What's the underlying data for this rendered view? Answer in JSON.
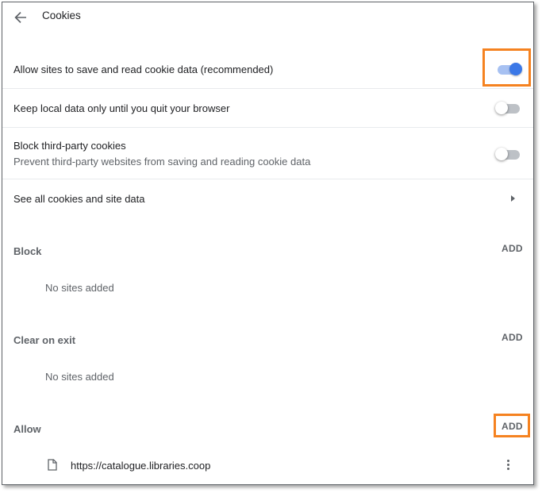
{
  "header": {
    "title": "Cookies",
    "back_icon": "arrow-back-icon"
  },
  "settings": [
    {
      "label": "Allow sites to save and read cookie data (recommended)",
      "enabled": true
    },
    {
      "label": "Keep local data only until you quit your browser",
      "enabled": false
    },
    {
      "label": "Block third-party cookies",
      "sublabel": "Prevent third-party websites from saving and reading cookie data",
      "enabled": false
    }
  ],
  "see_all": {
    "label": "See all cookies and site data",
    "icon": "arrow-right-icon"
  },
  "sections": {
    "block": {
      "title": "Block",
      "add_label": "ADD",
      "empty_text": "No sites added"
    },
    "clear_on_exit": {
      "title": "Clear on exit",
      "add_label": "ADD",
      "empty_text": "No sites added"
    },
    "allow": {
      "title": "Allow",
      "add_label": "ADD",
      "sites": [
        {
          "url": "https://catalogue.libraries.coop",
          "icon": "file-icon"
        }
      ]
    }
  },
  "colors": {
    "accent": "#3b78e7",
    "highlight": "#f58220"
  }
}
